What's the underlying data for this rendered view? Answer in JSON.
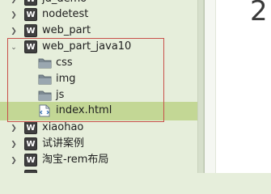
{
  "explorer": {
    "items": [
      {
        "label": "jd_demo",
        "icon": "web-project-icon",
        "expanded": false
      },
      {
        "label": "nodetest",
        "icon": "web-project-icon",
        "expanded": false
      },
      {
        "label": "web_part",
        "icon": "web-project-icon",
        "expanded": false
      },
      {
        "label": "web_part_java10",
        "icon": "web-project-icon",
        "expanded": true
      },
      {
        "label": "css",
        "icon": "folder-icon"
      },
      {
        "label": "img",
        "icon": "folder-icon"
      },
      {
        "label": "js",
        "icon": "folder-icon"
      },
      {
        "label": "index.html",
        "icon": "html-file-icon",
        "selected": true
      },
      {
        "label": "xiaohao",
        "icon": "web-project-icon",
        "expanded": false
      },
      {
        "label": "试讲案例",
        "icon": "web-project-icon",
        "expanded": false
      },
      {
        "label": "淘宝-rem布局",
        "icon": "web-project-icon",
        "expanded": false
      }
    ],
    "highlight_color": "#c8504a",
    "selected_color": "#c3d795"
  },
  "editor": {
    "line_number": "2"
  }
}
